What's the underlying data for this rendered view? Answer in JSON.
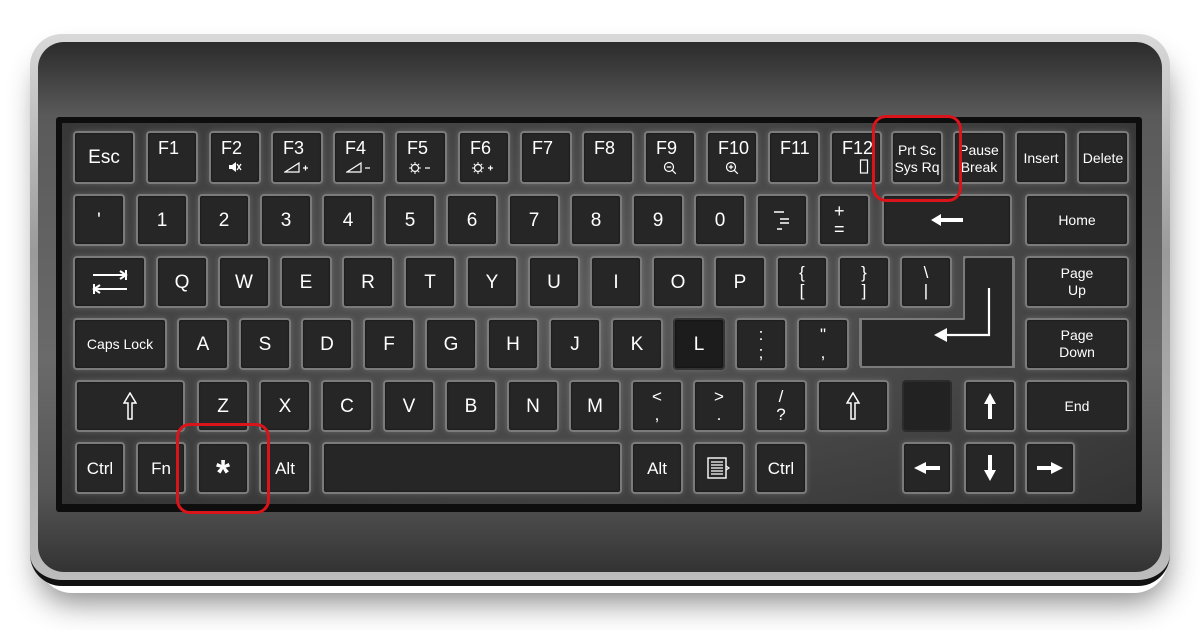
{
  "keyboard": {
    "row_function": [
      {
        "label": "Esc"
      },
      {
        "label": "F1",
        "sub": ""
      },
      {
        "label": "F2",
        "sub": "🔇"
      },
      {
        "label": "F3",
        "sub": "◿+"
      },
      {
        "label": "F4",
        "sub": "◿−"
      },
      {
        "label": "F5",
        "sub": "☼−"
      },
      {
        "label": "F6",
        "sub": "☼+"
      },
      {
        "label": "F7",
        "sub": ""
      },
      {
        "label": "F8",
        "sub": ""
      },
      {
        "label": "F9",
        "sub": "⊖"
      },
      {
        "label": "F10",
        "sub": "⊕"
      },
      {
        "label": "F11",
        "sub": ""
      },
      {
        "label": "F12",
        "sub": "▯"
      },
      {
        "top": "Prt Sc",
        "bottom": "Sys Rq"
      },
      {
        "top": "Pause",
        "bottom": "Break"
      },
      {
        "label": "Insert"
      },
      {
        "label": "Delete"
      }
    ],
    "row_number": [
      {
        "label": "'"
      },
      {
        "label": "1"
      },
      {
        "label": "2"
      },
      {
        "label": "3"
      },
      {
        "label": "4"
      },
      {
        "label": "5"
      },
      {
        "label": "6"
      },
      {
        "label": "7"
      },
      {
        "label": "8"
      },
      {
        "label": "9"
      },
      {
        "label": "0"
      },
      {
        "label": "−"
      },
      {
        "top": "+",
        "bottom": "="
      },
      {
        "label": "Backspace",
        "icon": "arrow-left"
      },
      {
        "label": "Home"
      }
    ],
    "row_qwerty": [
      {
        "label": "Tab",
        "icon": "tab"
      },
      {
        "label": "Q"
      },
      {
        "label": "W"
      },
      {
        "label": "E"
      },
      {
        "label": "R"
      },
      {
        "label": "T"
      },
      {
        "label": "Y"
      },
      {
        "label": "U"
      },
      {
        "label": "I"
      },
      {
        "label": "O"
      },
      {
        "label": "P"
      },
      {
        "top": "{",
        "bottom": "["
      },
      {
        "top": "}",
        "bottom": "]"
      },
      {
        "top": "\\",
        "bottom": "|"
      },
      {
        "label": "Enter",
        "icon": "enter"
      },
      {
        "top": "Page",
        "bottom": "Up"
      }
    ],
    "row_home": [
      {
        "label": "Caps Lock"
      },
      {
        "label": "A"
      },
      {
        "label": "S"
      },
      {
        "label": "D"
      },
      {
        "label": "F"
      },
      {
        "label": "G"
      },
      {
        "label": "H"
      },
      {
        "label": "J"
      },
      {
        "label": "K"
      },
      {
        "label": "L"
      },
      {
        "top": ":",
        "bottom": ";"
      },
      {
        "top": "\"",
        "bottom": ","
      },
      {
        "top": "Page",
        "bottom": "Down"
      }
    ],
    "row_shift": [
      {
        "label": "⇧"
      },
      {
        "label": "Z"
      },
      {
        "label": "X"
      },
      {
        "label": "C"
      },
      {
        "label": "V"
      },
      {
        "label": "B"
      },
      {
        "label": "N"
      },
      {
        "label": "M"
      },
      {
        "top": "<",
        "bottom": ","
      },
      {
        "top": ">",
        "bottom": "."
      },
      {
        "top": "/",
        "bottom": "?"
      },
      {
        "label": "⇧"
      },
      {
        "label": ""
      },
      {
        "label": "↑"
      },
      {
        "label": "End"
      }
    ],
    "row_bottom": [
      {
        "label": "Ctrl"
      },
      {
        "label": "Fn"
      },
      {
        "label": "*"
      },
      {
        "label": "Alt"
      },
      {
        "label": ""
      },
      {
        "label": "Alt"
      },
      {
        "label": "Menu",
        "icon": "menu"
      },
      {
        "label": "Ctrl"
      },
      {
        "label": "←"
      },
      {
        "label": "↓"
      },
      {
        "label": "→"
      }
    ]
  },
  "highlights": [
    {
      "target": "Prt Sc / Sys Rq",
      "color": "#d9141b"
    },
    {
      "target": "Windows (*) key",
      "color": "#d9141b"
    }
  ]
}
